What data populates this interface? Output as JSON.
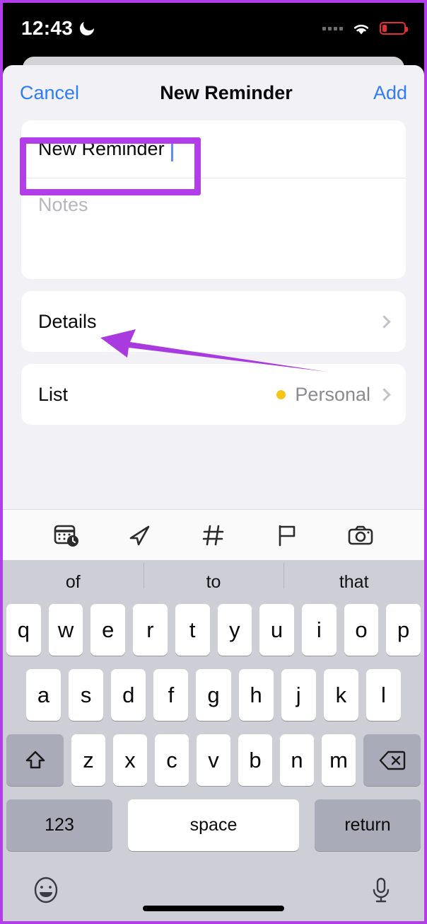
{
  "status_bar": {
    "time": "12:43",
    "moon_icon": "crescent-moon-icon",
    "wifi_icon": "wifi-icon",
    "battery_icon": "battery-low-icon",
    "battery_color": "#e03030"
  },
  "nav": {
    "cancel_label": "Cancel",
    "title": "New Reminder",
    "add_label": "Add",
    "accent_color": "#2f7cf6"
  },
  "form": {
    "title_value": "New Reminder",
    "notes_placeholder": "Notes",
    "details_label": "Details",
    "list_label": "List",
    "list_value": "Personal",
    "list_dot_color": "#f5c518"
  },
  "accessory_toolbar": {
    "icons": [
      "calendar-clock-icon",
      "location-arrow-icon",
      "hashtag-icon",
      "flag-icon",
      "camera-icon"
    ]
  },
  "keyboard": {
    "predictions": [
      "of",
      "to",
      "that"
    ],
    "row1": [
      "q",
      "w",
      "e",
      "r",
      "t",
      "y",
      "u",
      "i",
      "o",
      "p"
    ],
    "row2": [
      "a",
      "s",
      "d",
      "f",
      "g",
      "h",
      "j",
      "k",
      "l"
    ],
    "row3": [
      "z",
      "x",
      "c",
      "v",
      "b",
      "n",
      "m"
    ],
    "shift_icon": "shift-arrow-icon",
    "delete_icon": "backspace-icon",
    "numbers_label": "123",
    "space_label": "space",
    "return_label": "return",
    "emoji_icon": "emoji-smiley-icon",
    "mic_icon": "microphone-icon"
  },
  "annotations": {
    "color": "#b13ee8",
    "highlight_box_target": "reminder-title-field",
    "arrow_target": "details-row"
  }
}
